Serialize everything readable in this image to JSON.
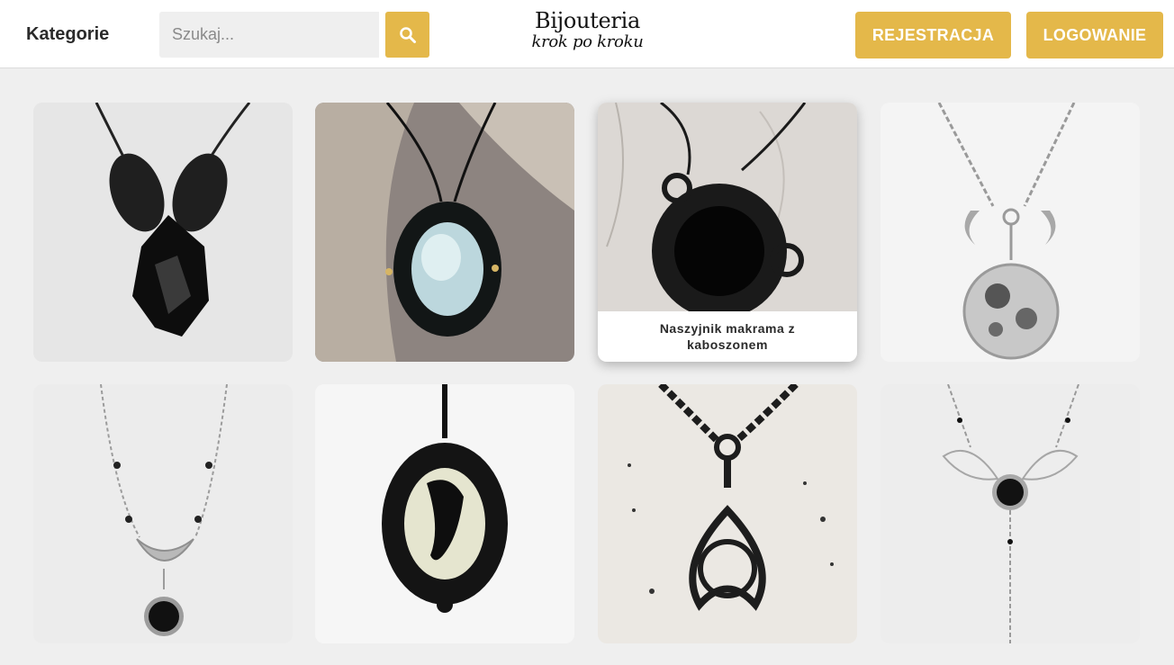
{
  "header": {
    "categories_label": "Kategorie",
    "search_placeholder": "Szukaj...",
    "logo_line1": "Bijouteria",
    "logo_line2": "krok po kroku",
    "register_label": "REJESTRACJA",
    "login_label": "LOGOWANIE",
    "accent_color": "#e4b84a"
  },
  "products": [
    {
      "caption": ""
    },
    {
      "caption": ""
    },
    {
      "caption": "Naszyjnik makrama z kaboszonem"
    },
    {
      "caption": ""
    },
    {
      "caption": ""
    },
    {
      "caption": ""
    },
    {
      "caption": ""
    },
    {
      "caption": ""
    }
  ]
}
